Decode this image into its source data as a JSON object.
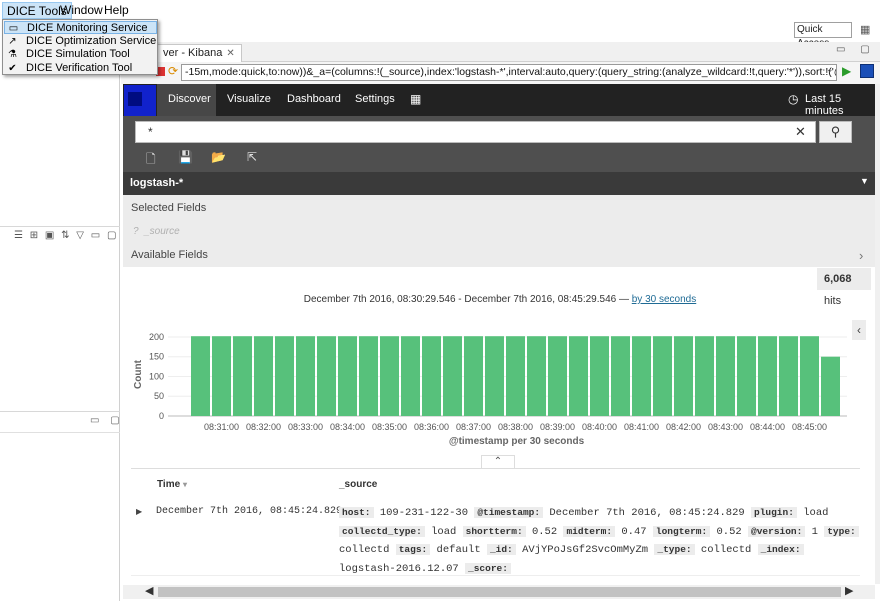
{
  "menu": {
    "items": [
      "DICE Tools",
      "Window",
      "Help"
    ],
    "dropdown": [
      {
        "label": "DICE Monitoring Service",
        "icon": "monitor-icon"
      },
      {
        "label": "DICE Optimization Service",
        "icon": "chart-line-icon"
      },
      {
        "label": "DICE Simulation Tool",
        "icon": "flask-icon"
      },
      {
        "label": "DICE Verification Tool",
        "icon": "check-circle-icon"
      }
    ]
  },
  "toolbar": {
    "quick_access": "Quick Access"
  },
  "editor": {
    "tab_title": "ver - Kibana",
    "url": "-15m,mode:quick,to:now))&_a=(columns:!(_source),index:'logstash-*',interval:auto,query:(query_string:(analyze_wildcard:!t,query:'*')),sort:!('@timestamp',desc))"
  },
  "kibana": {
    "nav": {
      "discover": "Discover",
      "visualize": "Visualize",
      "dashboard": "Dashboard",
      "settings": "Settings",
      "time_range": "Last 15 minutes"
    },
    "search": {
      "query": "*"
    },
    "index_pattern": "logstash-*",
    "sidebar": {
      "selected_fields": "Selected Fields",
      "source_field": "_source",
      "available_fields": "Available Fields"
    },
    "hits": {
      "count": "6,068",
      "label": "hits"
    },
    "range": {
      "text": "December 7th 2016, 08:30:29.546 - December 7th 2016, 08:45:29.546 — ",
      "link": "by 30 seconds"
    },
    "table": {
      "col_time": "Time",
      "col_source": "_source",
      "row_time": "December 7th 2016, 08:45:24.829",
      "row_source": [
        [
          "host:",
          "109-231-122-30"
        ],
        [
          "@timestamp:",
          "December 7th 2016, 08:45:24.829"
        ],
        [
          "plugin:",
          "load"
        ],
        [
          "collectd_type:",
          "load"
        ],
        [
          "shortterm:",
          "0.52"
        ],
        [
          "midterm:",
          "0.47"
        ],
        [
          "longterm:",
          "0.52"
        ],
        [
          "@version:",
          "1"
        ],
        [
          "type:",
          "collectd"
        ],
        [
          "tags:",
          "default"
        ],
        [
          "_id:",
          "AVjYPoJsGf2SvcOmMyZm"
        ],
        [
          "_type:",
          "collectd"
        ],
        [
          "_index:",
          "logstash-2016.12.07"
        ],
        [
          "_score:",
          ""
        ]
      ]
    }
  },
  "chart_data": {
    "type": "bar",
    "xlabel": "@timestamp per 30 seconds",
    "ylabel": "Count",
    "ylim": [
      0,
      210
    ],
    "yticks": [
      0,
      50,
      100,
      150,
      200
    ],
    "tick_labels": [
      "08:31:00",
      "08:32:00",
      "08:33:00",
      "08:34:00",
      "08:35:00",
      "08:36:00",
      "08:37:00",
      "08:38:00",
      "08:39:00",
      "08:40:00",
      "08:41:00",
      "08:42:00",
      "08:43:00",
      "08:44:00",
      "08:45:00"
    ],
    "values": [
      202,
      202,
      202,
      202,
      202,
      202,
      202,
      202,
      202,
      202,
      202,
      202,
      202,
      202,
      202,
      202,
      202,
      202,
      202,
      202,
      202,
      202,
      202,
      202,
      202,
      202,
      202,
      202,
      202,
      202,
      150
    ],
    "color": "#57c17b"
  }
}
